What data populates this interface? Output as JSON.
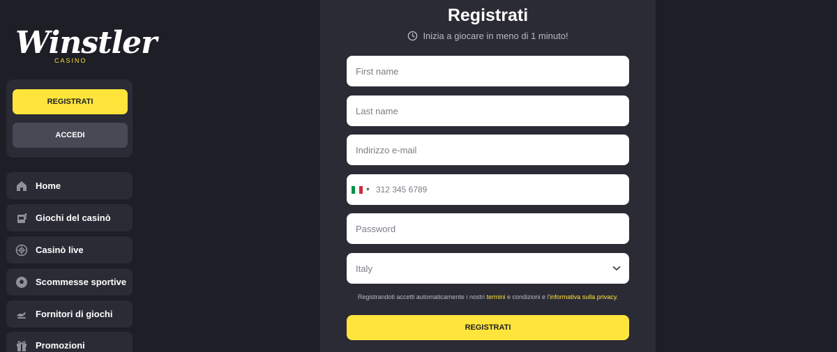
{
  "sidebar": {
    "logo": {
      "word": "Winstler",
      "sub": "CASINO"
    },
    "register_label": "REGISTRATI",
    "login_label": "ACCEDI",
    "items": [
      {
        "label": "Home",
        "icon": "home-icon"
      },
      {
        "label": "Giochi del casinò",
        "icon": "slot-machine-icon"
      },
      {
        "label": "Casinò live",
        "icon": "roulette-icon"
      },
      {
        "label": "Scommesse sportive",
        "icon": "soccer-ball-icon"
      },
      {
        "label": "Fornitori di giochi",
        "icon": "providers-icon"
      },
      {
        "label": "Promozioni",
        "icon": "gift-icon"
      }
    ]
  },
  "form": {
    "title": "Registrati",
    "subtitle": "Inizia a giocare in meno di 1 minuto!",
    "first_name_placeholder": "First name",
    "last_name_placeholder": "Last name",
    "email_placeholder": "Indirizzo e-mail",
    "phone_placeholder": "312 345 6789",
    "password_placeholder": "Password",
    "country_value": "Italy",
    "terms": {
      "prefix": "Registrandoti accetti automaticamente i nostri",
      "terms_link": "termini",
      "middle": "e condizioni e l'",
      "privacy_link": "informativa sulla privacy."
    },
    "submit_label": "REGISTRATI"
  },
  "colors": {
    "accent": "#ffe53b",
    "background": "#1d1e26",
    "panel": "#2a2b35"
  }
}
